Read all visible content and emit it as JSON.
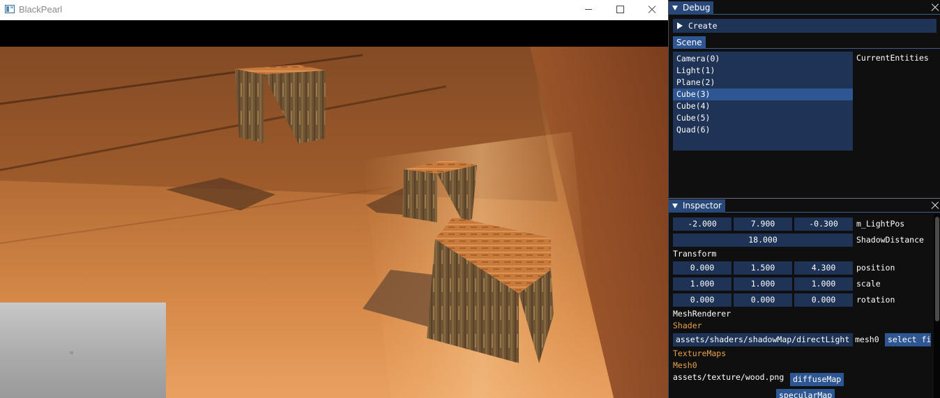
{
  "window": {
    "title": "BlackPearl"
  },
  "debug_panel": {
    "title": "Debug",
    "create_label": "Create",
    "scene_tab": "Scene",
    "entities": [
      "Camera(0)",
      "Light(1)",
      "Plane(2)",
      "Cube(3)",
      "Cube(4)",
      "Cube(5)",
      "Quad(6)"
    ],
    "selected_entity": "Cube(3)",
    "entities_label": "CurrentEntities"
  },
  "inspector": {
    "title": "Inspector",
    "light_pos": {
      "values": [
        "-2.000",
        "7.900",
        "-0.300"
      ],
      "label": "m_LightPos"
    },
    "shadow_distance": {
      "value": "18.000",
      "label": "ShadowDistance"
    },
    "transform": {
      "header": "Transform",
      "position": {
        "values": [
          "0.000",
          "1.500",
          "4.300"
        ],
        "label": "position"
      },
      "scale": {
        "values": [
          "1.000",
          "1.000",
          "1.000"
        ],
        "label": "scale"
      },
      "rotation": {
        "values": [
          "0.000",
          "0.000",
          "0.000"
        ],
        "label": "rotation"
      }
    },
    "mesh_renderer": {
      "header": "MeshRenderer",
      "shader_label": "Shader",
      "shader_path": "assets/shaders/shadowMap/directLight",
      "shader_suffix": "mesh0",
      "select_button": "select fi",
      "texture_maps_label": "TextureMaps",
      "mesh_label": "Mesh0",
      "texture_path": "assets/texture/wood.png",
      "diffuse_button": "diffuseMap",
      "specular_button": "specularMap"
    }
  },
  "colors": {
    "panel_bg": "#0f0f10",
    "title_active": "#29487a",
    "frame_bg": "#1e3355",
    "selection": "#2e5692",
    "section_text": "#e8a14b"
  }
}
